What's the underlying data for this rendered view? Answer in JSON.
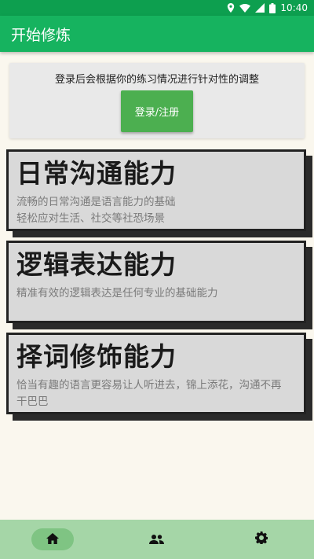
{
  "status_bar": {
    "time": "10:40",
    "icons": [
      "location-icon",
      "wifi-icon",
      "signal-icon",
      "battery-icon"
    ]
  },
  "app_bar": {
    "title": "开始修炼"
  },
  "login_card": {
    "hint": "登录后会根据你的练习情况进行针对性的调整",
    "button_label": "登录/注册"
  },
  "skills": [
    {
      "title": "日常沟通能力",
      "desc_lines": [
        "流畅的日常沟通是语言能力的基础",
        "轻松应对生活、社交等社恐场景"
      ]
    },
    {
      "title": "逻辑表达能力",
      "desc_lines": [
        "精准有效的逻辑表达是任何专业的基础能力"
      ]
    },
    {
      "title": "择词修饰能力",
      "desc_lines": [
        "恰当有趣的语言更容易让人听进去，锦上添花，沟通不再",
        "干巴巴"
      ]
    }
  ],
  "bottom_nav": {
    "items": [
      {
        "icon": "home-icon",
        "active": true
      },
      {
        "icon": "people-icon",
        "active": false
      },
      {
        "icon": "settings-icon",
        "active": false
      }
    ]
  },
  "colors": {
    "status_bar": "#0d9f4f",
    "app_bar": "#16b35f",
    "login_button": "#4caf50",
    "bottom_nav": "#a5d6a7",
    "nav_active": "#7fc483",
    "page_background": "#faf7ee",
    "card_background": "#d9d9d9"
  }
}
